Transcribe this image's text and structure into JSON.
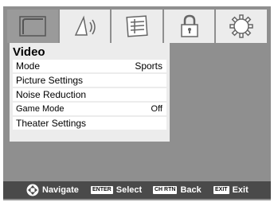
{
  "tabs": [
    {
      "icon": "picture-icon",
      "active": true
    },
    {
      "icon": "audio-icon",
      "active": false
    },
    {
      "icon": "setup-icon",
      "active": false
    },
    {
      "icon": "lock-icon",
      "active": false
    },
    {
      "icon": "gear-icon",
      "active": false
    }
  ],
  "menu": {
    "title": "Video",
    "items": [
      {
        "label": "Mode",
        "value": "Sports"
      },
      {
        "label": "Picture Settings",
        "value": ""
      },
      {
        "label": "Noise Reduction",
        "value": ""
      },
      {
        "label": "Game Mode",
        "value": "Off"
      },
      {
        "label": "Theater Settings",
        "value": ""
      }
    ]
  },
  "help": {
    "navigate_label": "Navigate",
    "enter_key": "ENTER",
    "select_label": "Select",
    "chrtn_key": "CH RTN",
    "back_label": "Back",
    "exit_key": "EXIT",
    "exit_label": "Exit"
  },
  "colors": {
    "frame": "#8f8f8f",
    "panel": "#ececec",
    "active_tab": "#9a9a9a",
    "helpbar": "#4a4a4a"
  }
}
